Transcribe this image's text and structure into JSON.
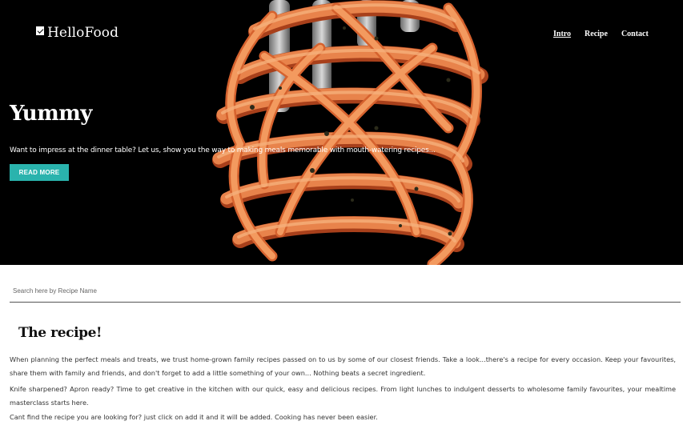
{
  "brand": {
    "name": "HelloFood"
  },
  "nav": {
    "items": [
      "Intro",
      "Recipe",
      "Contact"
    ],
    "active": "Intro"
  },
  "hero": {
    "title": "Yummy",
    "subtitle": "Want to impress at the dinner table? Let us, show you the way to making meals memorable with mouth-watering recipes...",
    "button_label": "READ MORE"
  },
  "search": {
    "placeholder": "Search here by Recipe Name",
    "value": ""
  },
  "content": {
    "title": "The recipe!",
    "paragraphs": [
      "When planning the perfect meals and treats, we trust home-grown family recipes passed on to us by some of our closest friends. Take a look...there's a recipe for every occasion. Keep your favourites, share them with family and friends, and don't forget to add a little something of your own... Nothing beats a secret ingredient.",
      "Knife sharpened? Apron ready? Time to get creative in the kitchen with our quick, easy and delicious recipes. From light lunches to indulgent desserts to wholesome family favourites, your mealtime masterclass starts here.",
      "Cant find the recipe you are looking for? just click on add it and it will be added. Cooking has never been easier."
    ]
  },
  "colors": {
    "accent": "#2ab3ad",
    "hero_bg": "#000000",
    "pasta": "#e87a45",
    "sauce": "#c8421c"
  }
}
